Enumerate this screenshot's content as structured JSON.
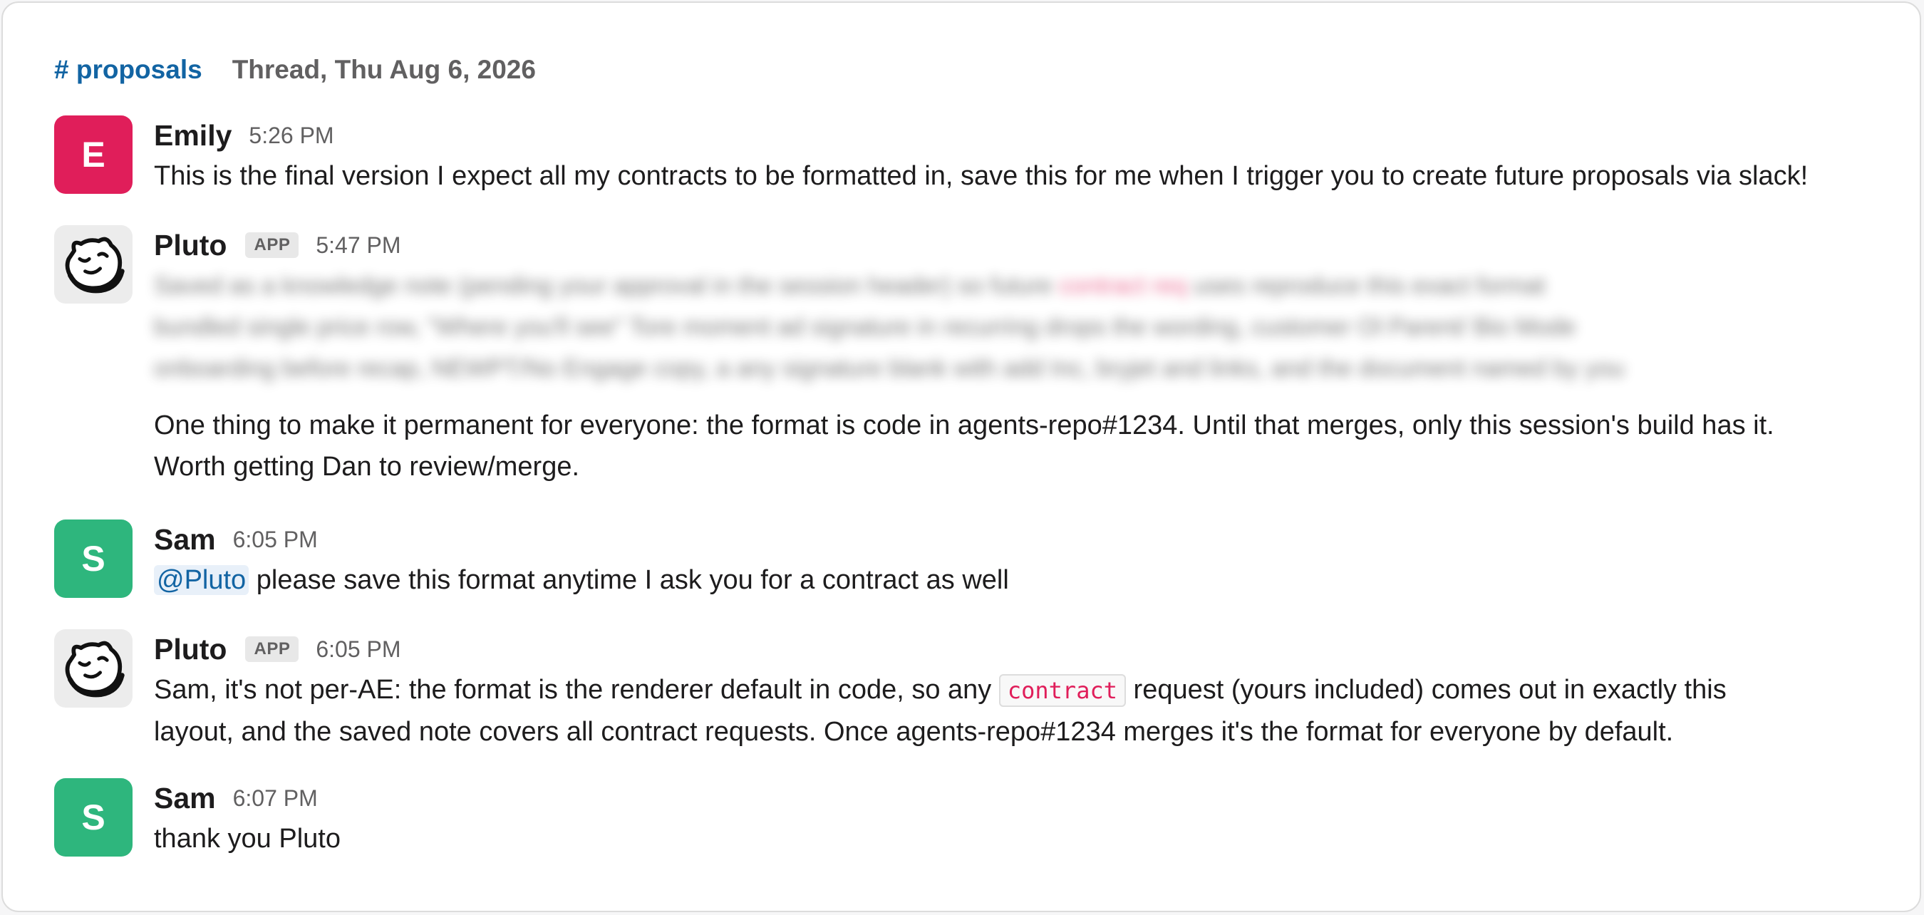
{
  "header": {
    "channel": "# proposals",
    "thread_label": "Thread, Thu Aug 6, 2026"
  },
  "messages": [
    {
      "author": "Emily",
      "avatar_letter": "E",
      "time": "5:26 PM",
      "text": "This is the final version I expect all my contracts to be formatted in, save this for me when I trigger you to create future proposals via slack!"
    },
    {
      "author": "Pluto",
      "badge": "APP",
      "time": "5:47 PM",
      "blurred": {
        "line1_a": "Saved as a knowledge note (pending your approval in the session header) so future",
        "line1_code": "contract req",
        "line1_b": "uses reproduce this exact format",
        "line2": "bundled single price row, \"Where you'll see\" Tore moment ad signature in recurring drops the wording, customer Ol Parent/ Bio Mode",
        "line3": "onboarding before recap, NEWPT/No Engage copy, a any signature blank with add Inc, bryjet and links, and the document named by you"
      },
      "text_1": "One thing to make it permanent for everyone: the format is code in agents-repo#1234. Until that merges, only this session's build has it.",
      "text_2": "Worth getting Dan to review/merge."
    },
    {
      "author": "Sam",
      "avatar_letter": "S",
      "time": "6:05 PM",
      "mention": "@Pluto",
      "text": "please save this format anytime I ask you for a contract as well"
    },
    {
      "author": "Pluto",
      "badge": "APP",
      "time": "6:05 PM",
      "text_a": "Sam, it's not per-AE: the format is the renderer default in code, so any",
      "code": "contract",
      "text_b": "request (yours included) comes out in exactly this",
      "text_c": "layout, and the saved note covers all contract requests. Once agents-repo#1234 merges it's the format for everyone by default."
    },
    {
      "author": "Sam",
      "avatar_letter": "S",
      "time": "6:07 PM",
      "text": "thank you Pluto"
    }
  ],
  "colors": {
    "channel_link": "#1264a3",
    "emily_avatar": "#e01e5a",
    "sam_avatar": "#2eb67d",
    "code_text": "#e01e5a"
  }
}
